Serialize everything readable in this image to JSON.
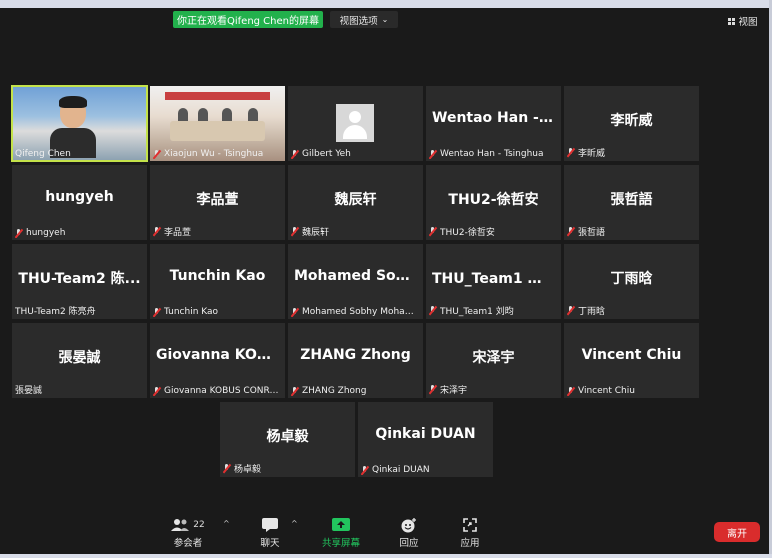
{
  "window": {
    "sharing_banner": "你正在观看Qifeng Chen的屏幕",
    "view_options": "视图选项",
    "view_button": "视图"
  },
  "participants": [
    {
      "id": "p0",
      "big": "",
      "label": "Qifeng Chen",
      "muted": false,
      "video": true
    },
    {
      "id": "p1",
      "big": "",
      "label": "Xiaojun Wu - Tsinghua",
      "muted": true,
      "video": true
    },
    {
      "id": "p2",
      "big": "",
      "label": "Gilbert Yeh",
      "muted": true,
      "avatar": true
    },
    {
      "id": "p3",
      "big": "Wentao Han - T...",
      "label": "Wentao Han - Tsinghua",
      "muted": true
    },
    {
      "id": "p4",
      "big": "李昕威",
      "label": "李昕威",
      "muted": true
    },
    {
      "id": "p5",
      "big": "hungyeh",
      "label": "hungyeh",
      "muted": true
    },
    {
      "id": "p6",
      "big": "李品萱",
      "label": "李品萱",
      "muted": true
    },
    {
      "id": "p7",
      "big": "魏辰轩",
      "label": "魏辰轩",
      "muted": true
    },
    {
      "id": "p8",
      "big": "THU2-徐哲安",
      "label": "THU2-徐哲安",
      "muted": true
    },
    {
      "id": "p9",
      "big": "張哲語",
      "label": "張哲語",
      "muted": true
    },
    {
      "id": "p10",
      "big": "THU-Team2 陈...",
      "label": "THU-Team2 陈亮舟",
      "muted": false
    },
    {
      "id": "p11",
      "big": "Tunchin Kao",
      "label": "Tunchin Kao",
      "muted": true
    },
    {
      "id": "p12",
      "big": "Mohamed Sobh...",
      "label": "Mohamed Sobhy Moham...",
      "muted": true
    },
    {
      "id": "p13",
      "big": "THU_Team1 刘昀",
      "label": "THU_Team1 刘昀",
      "muted": true
    },
    {
      "id": "p14",
      "big": "丁雨晗",
      "label": "丁雨晗",
      "muted": true
    },
    {
      "id": "p15",
      "big": "張晏誠",
      "label": "張晏誠",
      "muted": false
    },
    {
      "id": "p16",
      "big": "Giovanna KOBU...",
      "label": "Giovanna KOBUS CONRA...",
      "muted": true
    },
    {
      "id": "p17",
      "big": "ZHANG Zhong",
      "label": "ZHANG Zhong",
      "muted": true
    },
    {
      "id": "p18",
      "big": "宋泽宇",
      "label": "宋泽宇",
      "muted": true
    },
    {
      "id": "p19",
      "big": "Vincent Chiu",
      "label": "Vincent Chiu",
      "muted": true
    },
    {
      "id": "p20",
      "big": "杨卓毅",
      "label": "杨卓毅",
      "muted": true
    },
    {
      "id": "p21",
      "big": "Qinkai DUAN",
      "label": "Qinkai DUAN",
      "muted": true
    }
  ],
  "toolbar": {
    "participants_label": "参会者",
    "participants_count": "22",
    "chat_label": "聊天",
    "share_label": "共享屏幕",
    "reactions_label": "回应",
    "apps_label": "应用",
    "leave_label": "离开"
  },
  "colors": {
    "background": "#1a1a1a",
    "tile": "#2b2b2b",
    "share_green": "#22b14c",
    "active_speaker": "#c4e34a",
    "leave_red": "#d92c2c"
  }
}
